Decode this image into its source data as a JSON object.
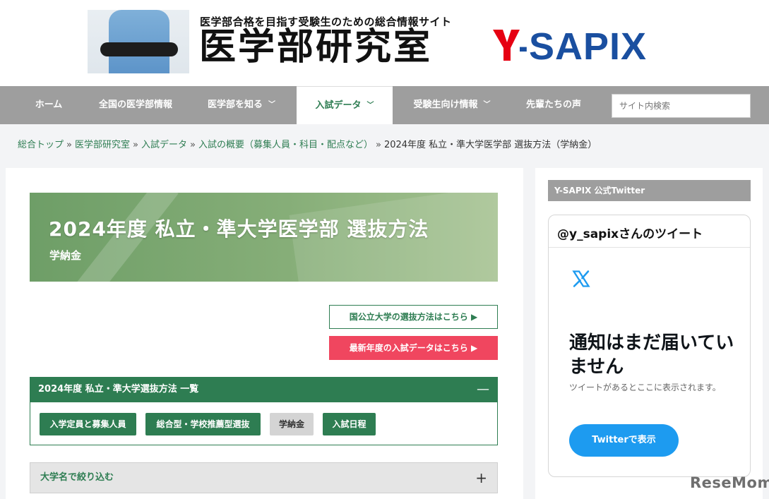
{
  "header": {
    "tagline": "医学部合格を目指す受験生のための総合情報サイト",
    "site_title": "医学部研究室",
    "brand": "Y-SAPIX",
    "brand_colors": {
      "red": "#e60012",
      "blue": "#1a4fa0"
    }
  },
  "nav": {
    "items": [
      {
        "label": "ホーム"
      },
      {
        "label": "全国の医学部情報"
      },
      {
        "label": "医学部を知る"
      },
      {
        "label": "入試データ"
      },
      {
        "label": "受験生向け情報"
      },
      {
        "label": "先輩たちの声"
      }
    ],
    "search_placeholder": "サイト内検索"
  },
  "breadcrumb": {
    "links": [
      "総合トップ",
      "医学部研究室",
      "入試データ",
      "入試の概要（募集人員・科目・配点など）"
    ],
    "separator": "»",
    "current": "2024年度 私立・準大学医学部 選抜方法（学納金）"
  },
  "banner": {
    "title": "2024年度 私立・準大学医学部 選抜方法",
    "subtitle": "学納金"
  },
  "buttons": {
    "national": "国公立大学の選抜方法はこちら ▶",
    "latest": "最新年度の入試データはこちら ▶"
  },
  "panel": {
    "title": "2024年度 私立・準大学選抜方法 一覧",
    "collapse_symbol": "—",
    "chips": [
      {
        "label": "入学定員と募集人員"
      },
      {
        "label": "総合型・学校推薦型選抜"
      },
      {
        "label": "学納金"
      },
      {
        "label": "入試日程"
      }
    ]
  },
  "filter": {
    "label": "大学名で絞り込む",
    "expand_symbol": "+"
  },
  "sidebar": {
    "heading": "Y-SAPIX 公式Twitter",
    "timeline": {
      "title": "@y_sapixさんのツイート",
      "message": "通知はまだ届いていません",
      "note": "ツイートがあるとここに表示されます。",
      "button": "Twitterで表示"
    }
  },
  "watermark": "ReseMom",
  "colors": {
    "accent_green": "#2e7d52",
    "nav_gray": "#9e9e9e",
    "cta_red": "#f0465f",
    "twitter_blue": "#1d9bf0"
  }
}
